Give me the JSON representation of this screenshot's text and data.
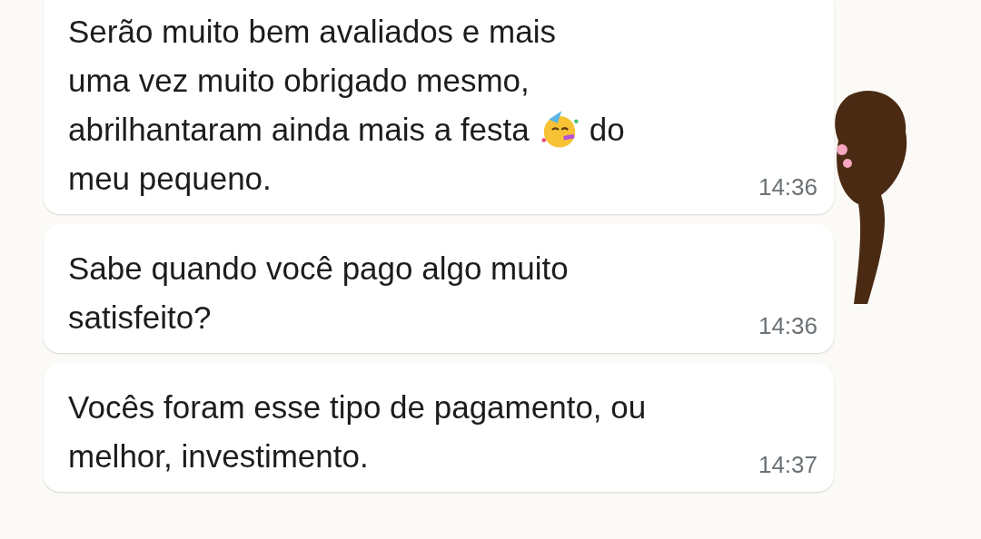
{
  "messages": [
    {
      "lines": [
        [
          {
            "kind": "text",
            "text": "Serão muito bem avaliados e mais"
          }
        ],
        [
          {
            "kind": "text",
            "text": "uma vez muito obrigado mesmo,"
          }
        ],
        [
          {
            "kind": "text",
            "text": "abrilhantaram ainda mais a festa"
          },
          {
            "kind": "emoji"
          },
          {
            "kind": "text",
            "text": "do"
          }
        ],
        [
          {
            "kind": "text",
            "text": "meu pequeno."
          }
        ]
      ],
      "time": "14:36"
    },
    {
      "lines": [
        [
          {
            "kind": "text",
            "text": "Sabe quando você pago algo muito"
          }
        ],
        [
          {
            "kind": "text",
            "text": "satisfeito?"
          }
        ]
      ],
      "time": "14:36"
    },
    {
      "lines": [
        [
          {
            "kind": "text",
            "text": "Vocês foram esse tipo de pagamento, ou"
          }
        ],
        [
          {
            "kind": "text",
            "text": "melhor, investimento."
          }
        ]
      ],
      "time": "14:37"
    }
  ]
}
